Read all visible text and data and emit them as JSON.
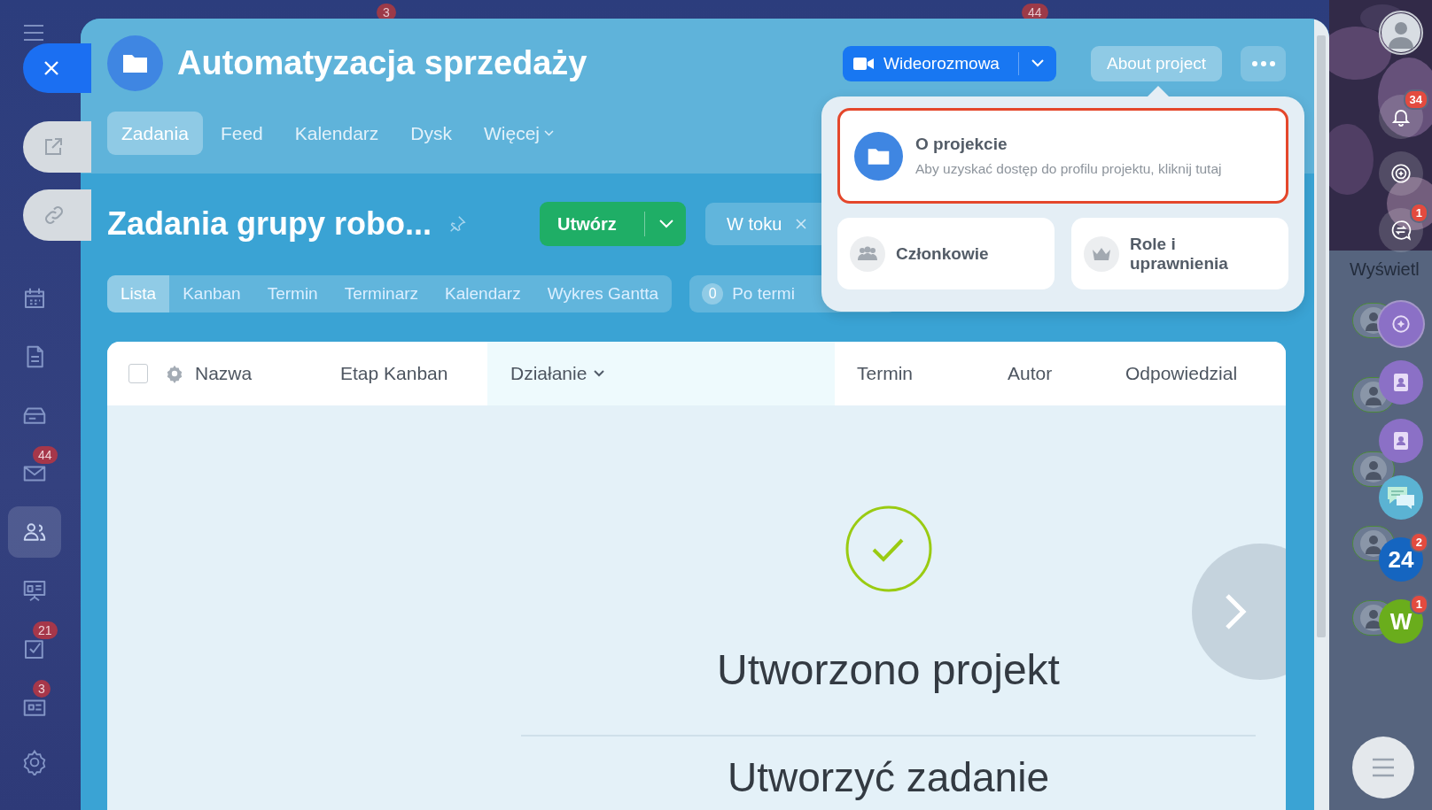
{
  "background_badges": [
    "3",
    "44"
  ],
  "left_nav": {
    "items": [
      {
        "selected": false
      },
      {
        "selected": false
      },
      {
        "selected": false
      },
      {
        "selected": false,
        "badge": "44"
      },
      {
        "selected": true
      },
      {
        "selected": false
      },
      {
        "selected": false,
        "badge": "21"
      },
      {
        "selected": false,
        "badge": "3"
      }
    ]
  },
  "header": {
    "title": "Automatyzacja sprzedaży",
    "video_button": "Wideorozmowa",
    "about_button": {
      "label": "About project",
      "selected": true
    }
  },
  "tabs": [
    {
      "label": "Zadania",
      "selected": true
    },
    {
      "label": "Feed",
      "selected": false
    },
    {
      "label": "Kalendarz",
      "selected": false
    },
    {
      "label": "Dysk",
      "selected": false
    },
    {
      "label": "Więcej",
      "selected": false,
      "dropdown": true
    }
  ],
  "toolbar": {
    "title": "Zadania grupy robo...",
    "create_button": "Utwórz",
    "filter_chip": "W toku"
  },
  "view_tabs": [
    {
      "label": "Lista",
      "selected": true
    },
    {
      "label": "Kanban",
      "selected": false
    },
    {
      "label": "Termin",
      "selected": false
    },
    {
      "label": "Terminarz",
      "selected": false
    },
    {
      "label": "Kalendarz",
      "selected": false
    },
    {
      "label": "Wykres Gantta",
      "selected": false
    }
  ],
  "counter": {
    "count": "0",
    "label": "Po termi"
  },
  "table": {
    "select_all_checked": false,
    "columns": [
      {
        "label": "Nazwa",
        "selected": false
      },
      {
        "label": "Etap Kanban",
        "selected": false
      },
      {
        "label": "Działanie",
        "selected": true
      },
      {
        "label": "Termin",
        "selected": false
      },
      {
        "label": "Autor",
        "selected": false
      },
      {
        "label": "Odpowiedzial",
        "selected": false
      }
    ]
  },
  "empty_state": {
    "title": "Utworzono projekt",
    "subtitle": "Utworzyć zadanie"
  },
  "popup": {
    "main": {
      "title": "O projekcie",
      "description": "Aby uzyskać dostęp do profilu projektu, kliknij tutaj",
      "highlighted": true
    },
    "cards": [
      {
        "label": "Członkowie"
      },
      {
        "label": "Role i uprawnienia"
      }
    ]
  },
  "right_bar": {
    "notifications_badge": "34",
    "transfer_badge": "1",
    "list_label": "Wyświetl",
    "apps": [
      {
        "label": "24",
        "badge": "2",
        "color": "#1565c0"
      },
      {
        "label": "W",
        "badge": "1",
        "color": "#6aad1c"
      }
    ]
  }
}
